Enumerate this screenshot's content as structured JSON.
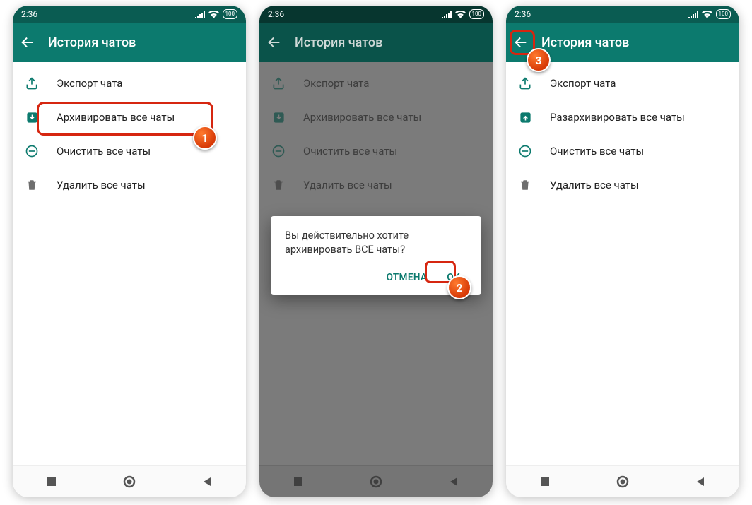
{
  "status": {
    "time": "2:36",
    "battery": "100"
  },
  "appbar": {
    "title": "История чатов"
  },
  "rows": {
    "export": "Экспорт чата",
    "archive": "Архивировать все чаты",
    "unarchive": "Разархивировать все чаты",
    "clear": "Очистить все чаты",
    "delete": "Удалить все чаты"
  },
  "dialog": {
    "msg_l1": "Вы действительно хотите",
    "msg_l2": "архивировать ВСЕ чаты?",
    "cancel": "ОТМЕНА",
    "ok": "OK"
  },
  "badges": {
    "b1": "1",
    "b2": "2",
    "b3": "3"
  }
}
